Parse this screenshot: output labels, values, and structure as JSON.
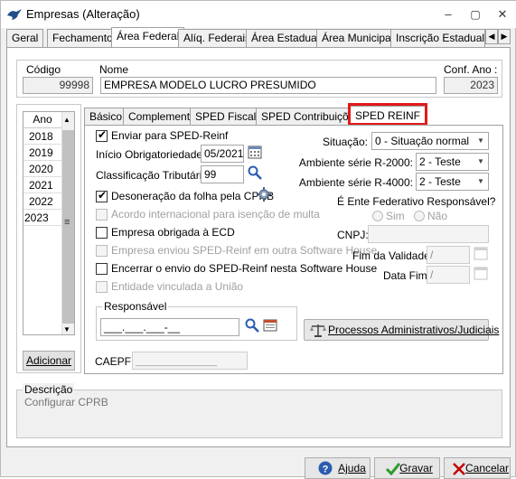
{
  "window": {
    "title": "Empresas (Alteração)",
    "minimize": "–",
    "restore": "▢",
    "close": "✕"
  },
  "tabs": [
    "Geral",
    "Fechamento",
    "Área Federal",
    "Alíq. Federais",
    "Área Estadual",
    "Área Municipal",
    "Inscrição Estadual S"
  ],
  "tab_scroll": {
    "left": "◀",
    "right": "▶"
  },
  "header": {
    "codigo_label": "Código",
    "codigo_value": "99998",
    "nome_label": "Nome",
    "nome_value": "EMPRESA MODELO LUCRO PRESUMIDO",
    "conf_ano_label": "Conf. Ano :",
    "conf_ano_value": "2023"
  },
  "year_list": {
    "header": "Ano",
    "items": [
      "2018",
      "2019",
      "2020",
      "2021",
      "2022",
      "2023"
    ],
    "add_button": "Adicionar",
    "scroll_grip": "≡"
  },
  "subtabs": [
    "Básico",
    "Complemento",
    "SPED Fiscal",
    "SPED Contribuições",
    "SPED REINF"
  ],
  "reinf": {
    "enviar_label": "Enviar para SPED-Reinf",
    "inicio_label": "Início Obrigatoriedade:",
    "inicio_value": "05/2021",
    "classificacao_label": "Classificação Tributária:",
    "classificacao_value": "99",
    "situacao_label": "Situação:",
    "situacao_value": "0 - Situação normal",
    "amb_r2000_label": "Ambiente série R-2000:",
    "amb_r2000_value": "2 - Teste",
    "amb_r4000_label": "Ambiente série R-4000:",
    "amb_r4000_value": "2 - Teste",
    "desoneracao_label": "Desoneração da folha pela CPRB",
    "acordo_label": "Acordo internacional para isenção de multa",
    "ecd_label": "Empresa obrigada à ECD",
    "outra_sh_label": "Empresa enviou SPED-Reinf em outra Software House",
    "encerrar_label": "Encerrar o envio do SPED-Reinf nesta Software House",
    "entidade_label": "Entidade vinculada a União",
    "ente_label": "É Ente Federativo Responsável?",
    "sim_label": "Sim",
    "nao_label": "Não",
    "cnpj_label": "CNPJ:",
    "cnpj_value": "",
    "fim_validade_label": "Fim da Validade:",
    "fim_validade_value": "  /",
    "data_fim_label": "Data Fim:",
    "data_fim_value": "  /",
    "responsavel_label": "Responsável",
    "responsavel_value": "___.___.___-__",
    "processos_label": "Processos Administrativos/Judiciais",
    "caepf_label": "CAEPF:",
    "caepf_value": "__________________"
  },
  "descricao": {
    "label": "Descrição",
    "text": "Configurar CPRB"
  },
  "footer": {
    "ajuda": "Ajuda",
    "gravar": "Gravar",
    "cancelar": "Cancelar"
  },
  "colors": {
    "highlight": "#e01b1b",
    "gravar_check": "#2e9a2e",
    "cancelar_x": "#c00000",
    "help_blue": "#2a5db0"
  }
}
